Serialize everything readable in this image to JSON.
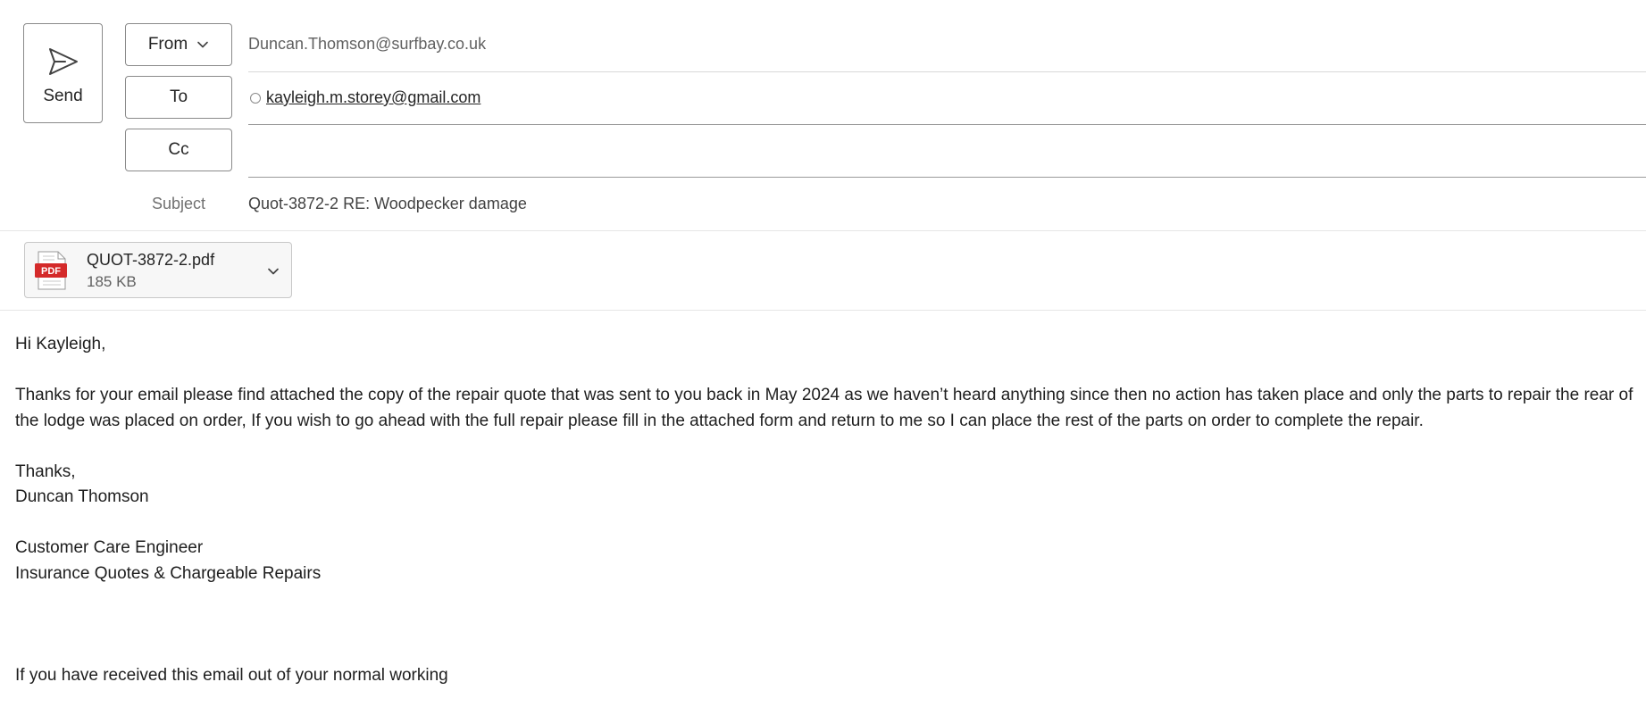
{
  "compose": {
    "send_label": "Send",
    "from": {
      "button_label": "From",
      "value": "Duncan.Thomson@surfbay.co.uk"
    },
    "to": {
      "button_label": "To",
      "recipients": [
        "kayleigh.m.storey@gmail.com"
      ]
    },
    "cc": {
      "button_label": "Cc",
      "value": ""
    },
    "subject": {
      "label": "Subject",
      "value": "Quot-3872-2 RE: Woodpecker damage"
    }
  },
  "attachment": {
    "icon_label": "PDF",
    "name": "QUOT-3872-2.pdf",
    "size": "185 KB"
  },
  "body": {
    "greeting": "Hi Kayleigh,",
    "paragraph": "Thanks for your email please find attached the copy of the repair quote that was sent to you back in May 2024 as we haven’t heard anything since then no action has taken place and only the parts to repair the rear of the lodge was placed on order, If you wish to go ahead with the full repair please fill in the attached form and return to me so I can place the rest of the parts on order to complete the repair.",
    "signoff": "Thanks,",
    "sender_name": "Duncan Thomson",
    "role": "Customer Care Engineer",
    "department": "Insurance Quotes & Chargeable Repairs",
    "footer_partial": "If you have received this email out of your normal working"
  },
  "icons": {
    "send": "send-icon",
    "from_dropdown": "chevron-down-icon",
    "recipient_status": "presence-icon",
    "attachment_type": "pdf-icon",
    "attachment_menu": "chevron-down-icon"
  },
  "colors": {
    "pdf_red": "#d42a2a",
    "border": "#8a8a8a",
    "muted_text": "#616161"
  }
}
